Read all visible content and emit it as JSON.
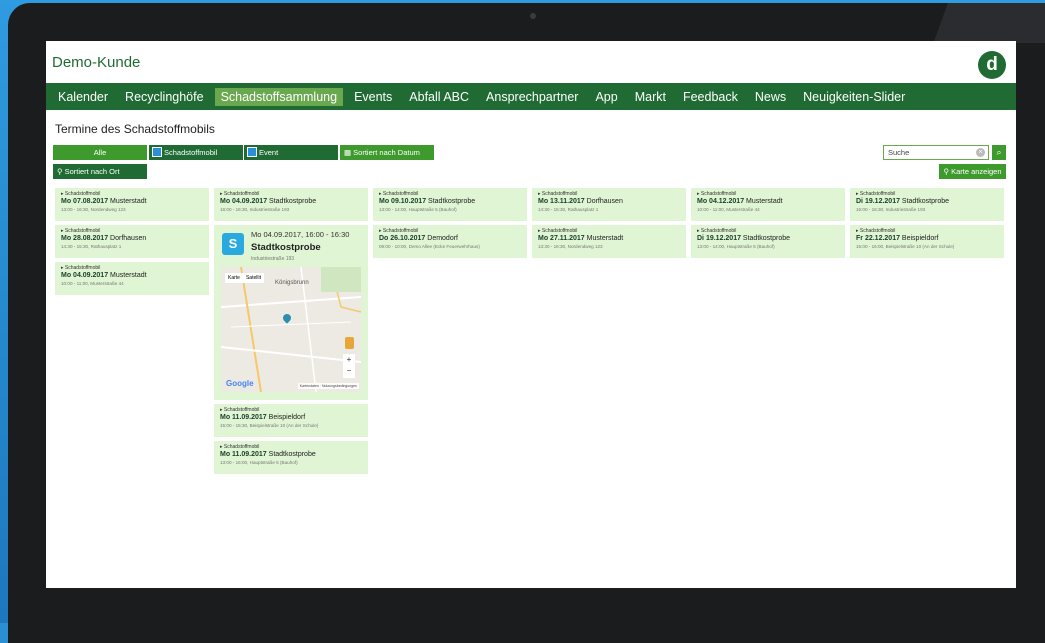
{
  "app": {
    "title": "Demo-Kunde",
    "logo_letter": "d",
    "accent": "#1f6b33",
    "active_tab_color": "#6aa84f"
  },
  "nav": {
    "items": [
      {
        "label": "Kalender"
      },
      {
        "label": "Recyclinghöfe"
      },
      {
        "label": "Schadstoffsammlung",
        "active": true
      },
      {
        "label": "Events"
      },
      {
        "label": "Abfall ABC"
      },
      {
        "label": "Ansprechpartner"
      },
      {
        "label": "App"
      },
      {
        "label": "Markt"
      },
      {
        "label": "Feedback"
      },
      {
        "label": "News"
      },
      {
        "label": "Neuigkeiten-Slider"
      }
    ]
  },
  "page": {
    "title": "Termine des Schadstoffmobils"
  },
  "filters": {
    "all": "Alle",
    "schadstoffmobil": "Schadstoffmobil",
    "event": "Event",
    "sort_date": "Sortiert nach Datum",
    "sort_ort": "Sortiert nach Ort",
    "search_placeholder": "Suche",
    "show_map": "Karte anzeigen"
  },
  "columns": [
    {
      "cards": [
        {
          "cat": "Schadstoffmobil",
          "day": "Mo 07.08.2017",
          "place": "Musterstadt",
          "addr": "13:00 - 16:30, Nordendweg 123"
        },
        {
          "cat": "Schadstoffmobil",
          "day": "Mo 28.08.2017",
          "place": "Dorfhausen",
          "addr": "14:30 - 15:30, Rathausplatz 1"
        },
        {
          "cat": "Schadstoffmobil",
          "day": "Mo 04.09.2017",
          "place": "Musterstadt",
          "addr": "10:00 - 11:00, Musterstraße 44"
        }
      ]
    },
    {
      "cards": [
        {
          "cat": "Schadstoffmobil",
          "day": "Mo 04.09.2017",
          "place": "Stadtkostprobe",
          "addr": "16:00 - 16:30, Industriestraße 193"
        }
      ],
      "expanded": {
        "date": "Mo 04.09.2017, 16:00 - 16:30",
        "title": "Stadtkostprobe",
        "addr": "Industriestraße 193",
        "icon": "S",
        "map": {
          "tab_map": "Karte",
          "tab_sat": "Satellit",
          "place_label": "Königsbrunn",
          "google": "Google",
          "footer": "Kartendaten · Nutzungsbedingungen"
        }
      },
      "cards_after": [
        {
          "cat": "Schadstoffmobil",
          "day": "Mo 11.09.2017",
          "place": "Beispieldorf",
          "addr": "15:00 - 15:30, Beispielstraße 10 (An der Schule)"
        },
        {
          "cat": "Schadstoffmobil",
          "day": "Mo 11.09.2017",
          "place": "Stadtkostprobe",
          "addr": "13:00 - 16:00, Hauptstraße 5 (Bauhof)"
        }
      ]
    },
    {
      "cards": [
        {
          "cat": "Schadstoffmobil",
          "day": "Mo 09.10.2017",
          "place": "Stadtkostprobe",
          "addr": "13:00 - 14:00, Hauptstraße 5 (Bauhof)"
        },
        {
          "cat": "Schadstoffmobil",
          "day": "Do 26.10.2017",
          "place": "Demodorf",
          "addr": "09:00 - 10:00, Demo Allee (Ecke Feuerwehrhaus)"
        }
      ]
    },
    {
      "cards": [
        {
          "cat": "Schadstoffmobil",
          "day": "Mo 13.11.2017",
          "place": "Dorfhausen",
          "addr": "14:30 - 15:30, Rathausplatz 1"
        },
        {
          "cat": "Schadstoffmobil",
          "day": "Mo 27.11.2017",
          "place": "Musterstadt",
          "addr": "13:30 - 16:30, Nordendweg 123"
        }
      ]
    },
    {
      "cards": [
        {
          "cat": "Schadstoffmobil",
          "day": "Mo 04.12.2017",
          "place": "Musterstadt",
          "addr": "10:00 - 11:00, Musterstraße 44"
        },
        {
          "cat": "Schadstoffmobil",
          "day": "Di 19.12.2017",
          "place": "Stadtkostprobe",
          "addr": "13:00 - 14:00, Hauptstraße 5 (Bauhof)"
        }
      ]
    },
    {
      "cards": [
        {
          "cat": "Schadstoffmobil",
          "day": "Di 19.12.2017",
          "place": "Stadtkostprobe",
          "addr": "16:00 - 16:30, Industriestraße 193"
        },
        {
          "cat": "Schadstoffmobil",
          "day": "Fr 22.12.2017",
          "place": "Beispieldorf",
          "addr": "15:00 - 16:00, Beispielstraße 10 (An der Schule)"
        }
      ]
    }
  ]
}
